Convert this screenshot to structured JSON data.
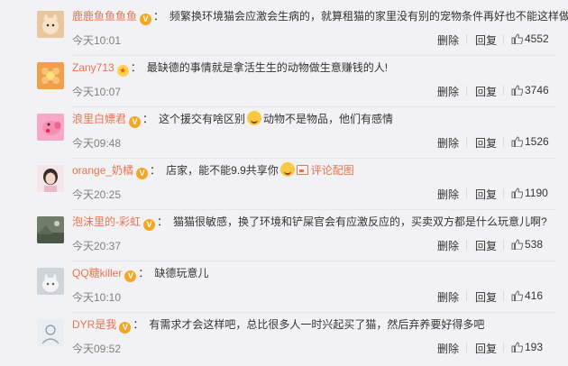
{
  "actions": {
    "delete": "删除",
    "reply": "回复"
  },
  "comments": [
    {
      "user": "鹿鹿鱼鱼鱼鱼",
      "badge": "vip",
      "text": "频繁换环境猫会应激会生病的，就算租猫的家里没有别的宠物条件再好也不能这样做",
      "time": "今天10:01",
      "likes": "4552",
      "avatar_color": "#e8c6a0",
      "avatar_icon": "cat-face-icon"
    },
    {
      "user": "Zany713",
      "badge": "star",
      "text": "最缺德的事情就是拿活生生的动物做生意赚钱的人!",
      "time": "今天10:07",
      "likes": "3746",
      "avatar_color": "#f0a04b",
      "avatar_icon": "flower-icon"
    },
    {
      "user": "浪里白嫖君",
      "badge": "vip",
      "text_before": "这个援交有啥区别",
      "text_after": "动物不是物品，他们有感情",
      "time": "今天09:48",
      "likes": "1526",
      "avatar_color": "#f7a8c4",
      "avatar_icon": "peppa-pig-icon",
      "emoji": "laugh-emoji"
    },
    {
      "user": "orange_奶橘",
      "badge": "vip",
      "text_before": "店家，能不能9.9共享你",
      "picture_link": "评论配图",
      "time": "今天20:25",
      "likes": "1190",
      "avatar_color": "#f3e6ea",
      "avatar_icon": "girl-portrait-icon",
      "emoji": "shy-emoji"
    },
    {
      "user": "泡沫里的-彩虹",
      "badge": "vip",
      "text": "猫猫很敏感，换了环境和铲屎官会有应激反应的，买卖双方都是什么玩意儿啊?",
      "time": "今天20:37",
      "likes": "538",
      "avatar_color": "#6f7d6a",
      "avatar_icon": "landscape-icon"
    },
    {
      "user": "QQ糖killer",
      "badge": "vip",
      "text": "缺德玩意儿",
      "time": "今天10:10",
      "likes": "416",
      "avatar_color": "#cfd4d8",
      "avatar_icon": "cat-photo-icon"
    },
    {
      "user": "DYR是我",
      "badge": "vip",
      "text": "有需求才会这样吧，总比很多人一时兴起买了猫，然后弃养要好得多吧",
      "time": "今天09:52",
      "likes": "193",
      "avatar_color": "#e9eef2",
      "avatar_icon": "sketch-icon"
    }
  ]
}
